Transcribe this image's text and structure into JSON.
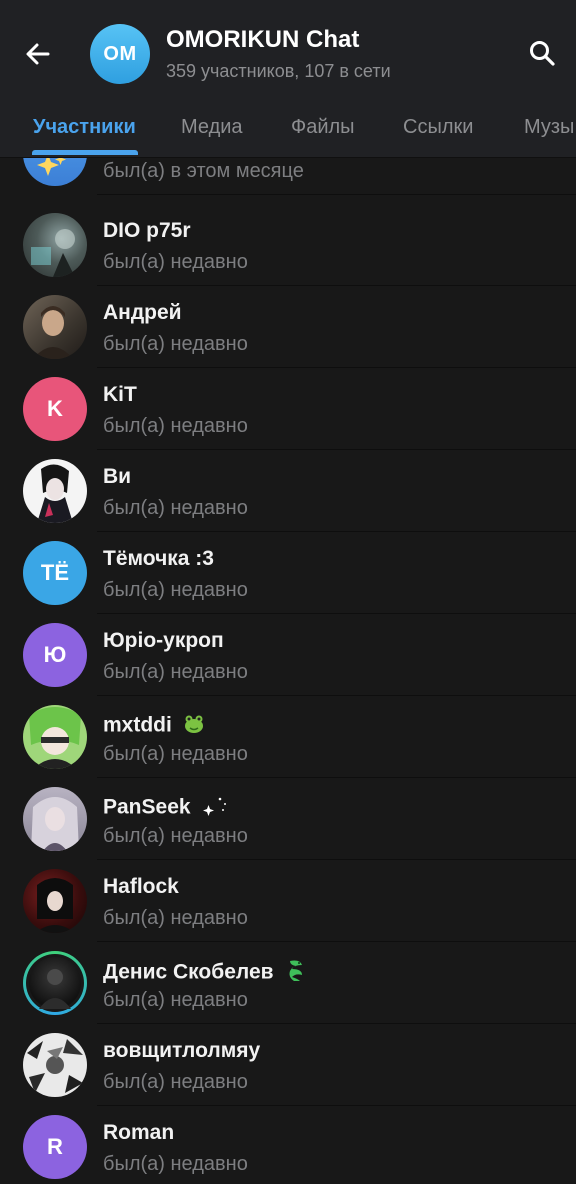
{
  "header": {
    "avatar_initials": "OM",
    "title": "OMORIKUN Chat",
    "subtitle": "359 участников, 107 в сети"
  },
  "tabs": [
    {
      "label": "Участники"
    },
    {
      "label": "Медиа"
    },
    {
      "label": "Файлы"
    },
    {
      "label": "Ссылки"
    },
    {
      "label": "Музы"
    }
  ],
  "members": [
    {
      "name": "",
      "status": "был(а) в этом месяце",
      "avatar": "photo"
    },
    {
      "name": "DIO p75r",
      "status": "был(а) недавно",
      "avatar": "photo"
    },
    {
      "name": "Андрей",
      "status": "был(а) недавно",
      "avatar": "photo"
    },
    {
      "name": "KiT",
      "status": "был(а) недавно",
      "avatar": "initials",
      "initials": "K",
      "color": "#e8557a"
    },
    {
      "name": "Ви",
      "status": "был(а) недавно",
      "avatar": "photo"
    },
    {
      "name": "Тёмочка :3",
      "status": "был(а) недавно",
      "avatar": "initials",
      "initials": "ТЁ",
      "color": "#3aa6e6"
    },
    {
      "name": "Юріо-укроп",
      "status": "был(а) недавно",
      "avatar": "initials",
      "initials": "Ю",
      "color": "#8c63e0"
    },
    {
      "name": "mxtddi",
      "status": "был(а) недавно",
      "avatar": "photo",
      "emoji": "frog-icon"
    },
    {
      "name": "PanSeek",
      "status": "был(а) недавно",
      "avatar": "photo",
      "emoji": "sparkle-icon"
    },
    {
      "name": "Haflock",
      "status": "был(а) недавно",
      "avatar": "photo"
    },
    {
      "name": "Денис Скобелев",
      "status": "был(а) недавно",
      "avatar": "photo",
      "emoji": "dragon-icon",
      "story_ring": true
    },
    {
      "name": "вовщитлолмяу",
      "status": "был(а) недавно",
      "avatar": "photo"
    },
    {
      "name": "Roman",
      "status": "был(а) недавно",
      "avatar": "initials",
      "initials": "R",
      "color": "#8c63e0"
    }
  ],
  "colors": {
    "accent": "#4aa3ed",
    "background": "#181818",
    "header": "#202124"
  }
}
